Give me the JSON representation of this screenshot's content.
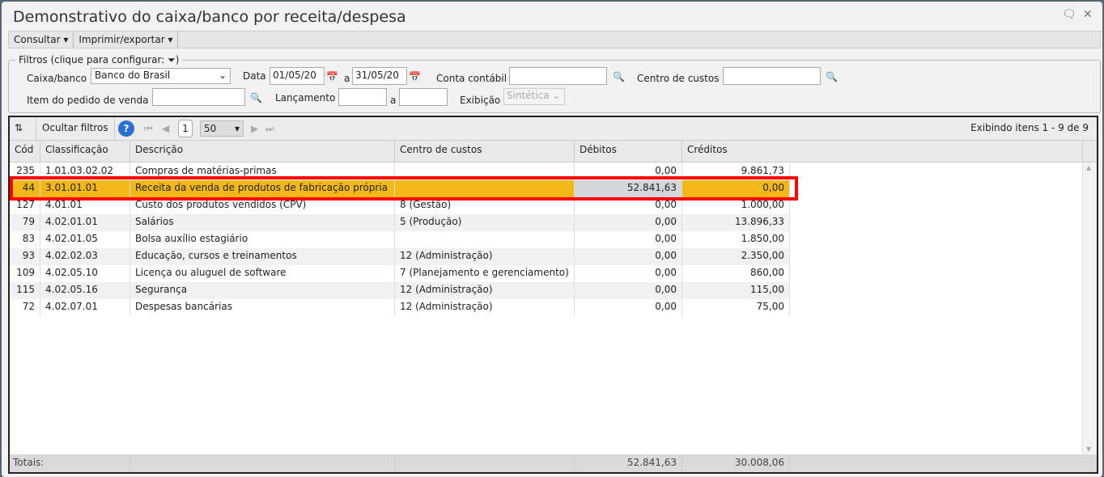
{
  "window": {
    "title": "Demonstrativo do caixa/banco por receita/despesa"
  },
  "menu": [
    "Consultar",
    "Imprimir/exportar"
  ],
  "filters": {
    "legend": "Filtros (clique para configurar:",
    "legend_close": ")",
    "caixa_label": "Caixa/banco",
    "caixa_value": "Banco do Brasil",
    "data_label": "Data",
    "date_from": "01/05/20",
    "a": "a",
    "date_to": "31/05/20",
    "conta_label": "Conta contábil",
    "centro_label": "Centro de custos",
    "item_label": "Item do pedido de venda",
    "lanc_label": "Lançamento",
    "exib_label": "Exibição",
    "exib_value": "Sintética"
  },
  "toolbar": {
    "hide_filters": "Ocultar filtros",
    "page": "1",
    "page_size": "50",
    "status": "Exibindo itens 1 - 9 de 9"
  },
  "columns": [
    "Cód",
    "Classificação",
    "Descrição",
    "Centro de custos",
    "Débitos",
    "Créditos"
  ],
  "rows": [
    [
      "235",
      "1.01.03.02.02",
      "Compras de matérias-primas",
      "",
      "0,00",
      "9.861,73"
    ],
    [
      "44",
      "3.01.01.01",
      "Receita da venda de produtos de fabricação própria",
      "",
      "52.841,63",
      "0,00"
    ],
    [
      "127",
      "4.01.01",
      "Custo dos produtos vendidos (CPV)",
      "8 (Gestão)",
      "0,00",
      "1.000,00"
    ],
    [
      "79",
      "4.02.01.01",
      "Salários",
      "5 (Produção)",
      "0,00",
      "13.896,33"
    ],
    [
      "83",
      "4.02.01.05",
      "Bolsa auxílio estagiário",
      "",
      "0,00",
      "1.850,00"
    ],
    [
      "93",
      "4.02.02.03",
      "Educação, cursos e treinamentos",
      "12 (Administração)",
      "0,00",
      "2.350,00"
    ],
    [
      "109",
      "4.02.05.10",
      "Licença ou aluguel de software",
      "7 (Planejamento e gerenciamento)",
      "0,00",
      "860,00"
    ],
    [
      "115",
      "4.02.05.16",
      "Segurança",
      "12 (Administração)",
      "0,00",
      "115,00"
    ],
    [
      "72",
      "4.02.07.01",
      "Despesas bancárias",
      "12 (Administração)",
      "0,00",
      "75,00"
    ]
  ],
  "totals": {
    "label": "Totais:",
    "debitos": "52.841,63",
    "creditos": "30.008,06"
  }
}
